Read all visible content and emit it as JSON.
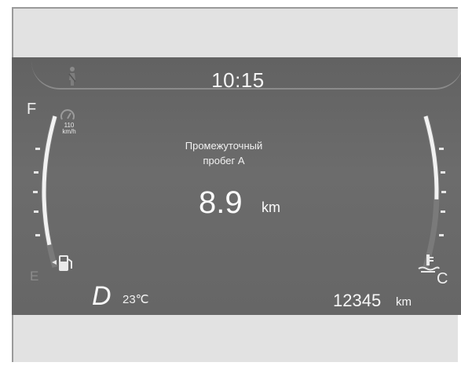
{
  "display": {
    "clock": "10:15",
    "trip": {
      "title_line1": "Промежуточный",
      "title_line2": "пробег А",
      "value": "8.9",
      "unit": "km"
    },
    "gear": "D",
    "outside_temp": "23℃",
    "odometer": {
      "value": "12345",
      "unit": "km"
    },
    "fuel_gauge": {
      "full_label": "F",
      "empty_label": "E",
      "level": 0.85
    },
    "temp_gauge": {
      "cold_label": "C",
      "level": 0.55
    },
    "speed_limit_label_top": "110",
    "speed_limit_label_bottom": "km/h"
  },
  "icons": [
    "seatbelt-warning-icon",
    "speed-limiter-icon",
    "fuel-pump-icon",
    "coolant-temperature-icon"
  ],
  "colors": {
    "screen_bg": "#666666",
    "text": "#f4f4f4",
    "frame_bg": "#e2e2e2"
  }
}
